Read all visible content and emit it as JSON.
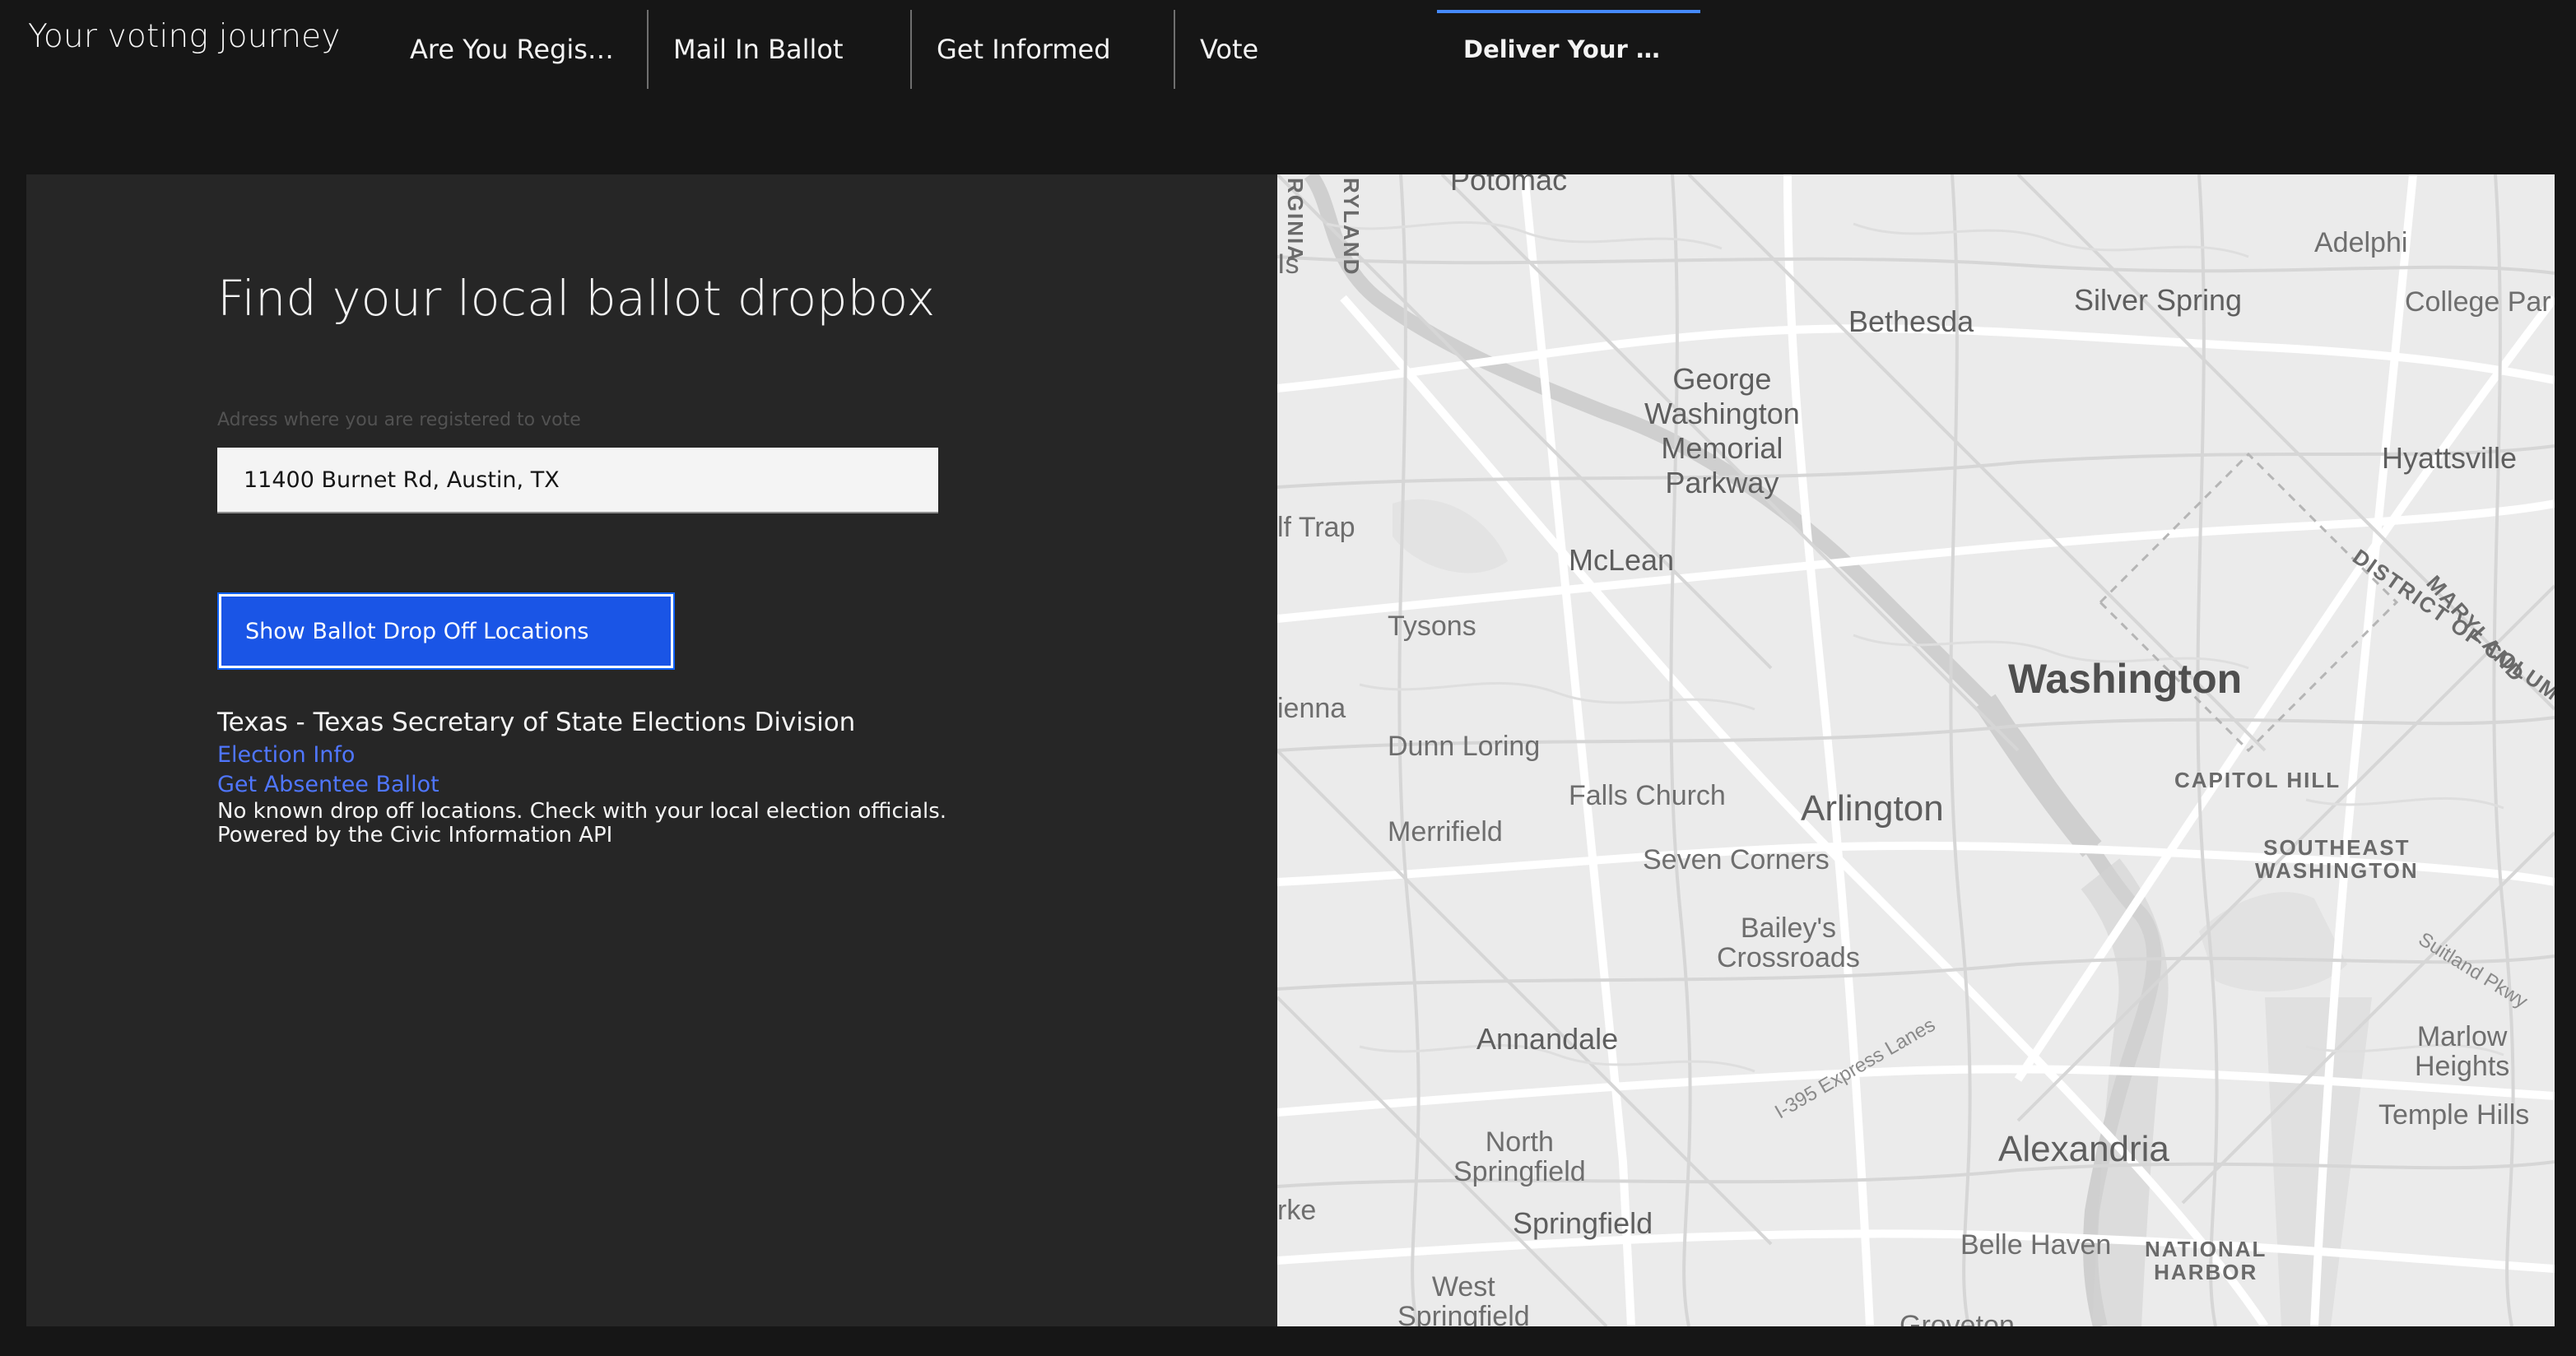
{
  "header": {
    "app_title": "Your voting journey",
    "tabs": [
      {
        "label": "Are You Registe...",
        "active": false
      },
      {
        "label": "Mail In Ballot",
        "active": false
      },
      {
        "label": "Get Informed",
        "active": false
      },
      {
        "label": "Vote",
        "active": false
      },
      {
        "label": "Deliver Your Ballot",
        "active": true
      }
    ]
  },
  "panel": {
    "title": "Find your local ballot dropbox",
    "address_label": "Adress where you are registered to vote",
    "address_value": "11400 Burnet Rd, Austin, TX",
    "show_button_label": "Show Ballot Drop Off Locations",
    "results": {
      "heading": "Texas - Texas Secretary of State Elections Division",
      "links": [
        "Election Info",
        "Get Absentee Ballot"
      ],
      "message": "No known drop off locations. Check with your local election officials.",
      "credit": "Powered by the Civic Information API"
    }
  },
  "map": {
    "labels": {
      "potomac": "Potomac",
      "virginia": "RGINIA",
      "maryland_w": "RYLAND",
      "is": "Is",
      "bethesda": "Bethesda",
      "silver_spring": "Silver Spring",
      "adelphi": "Adelphi",
      "college_park": "College Par",
      "gw_parkway": [
        "George",
        "Washington",
        "Memorial",
        "Parkway"
      ],
      "hyattsville": "Hyattsville",
      "wolf_trap": "lf Trap",
      "mclean": "McLean",
      "district_of_columbia": "DISTRICT OF COLUMB",
      "maryland_e": "MARYLAND",
      "tysons": "Tysons",
      "washington": "Washington",
      "vienna": "ienna",
      "dunn_loring": "Dunn Loring",
      "capitol_hill": "CAPITOL HILL",
      "falls_church": "Falls Church",
      "arlington": "Arlington",
      "merrifield": "Merrifield",
      "seven_corners": "Seven Corners",
      "southeast_washington": [
        "SOUTHEAST",
        "WASHINGTON"
      ],
      "baileys_crossroads": [
        "Bailey's",
        "Crossroads"
      ],
      "suitland_pkwy": "Suitland Pkwy",
      "i395": "I-395 Express Lanes",
      "annandale": "Annandale",
      "marlow_heights": [
        "Marlow",
        "Heights"
      ],
      "temple_hills": "Temple Hills",
      "north_springfield": [
        "North",
        "Springfield"
      ],
      "alexandria": "Alexandria",
      "burke": "rke",
      "springfield": "Springfield",
      "belle_haven": "Belle Haven",
      "national_harbor": [
        "NATIONAL",
        "HARBOR"
      ],
      "west_springfield": [
        "West",
        "Springfield"
      ],
      "groveton": "Groveton"
    }
  }
}
